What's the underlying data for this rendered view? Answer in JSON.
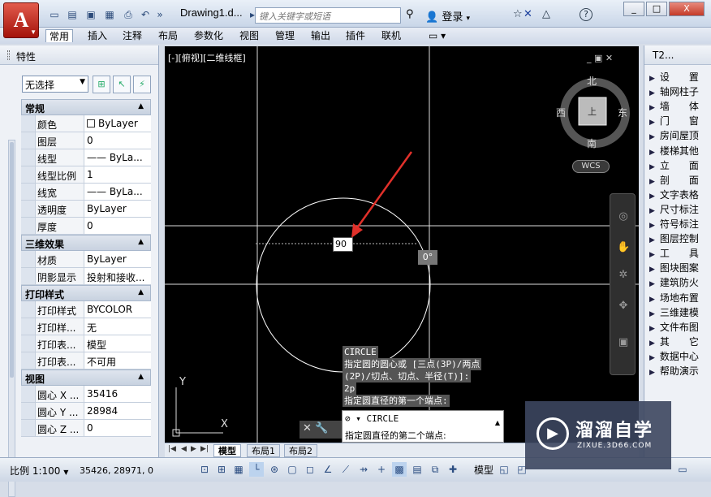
{
  "titlebar": {
    "app_glyph": "A",
    "doc_title": "Drawing1.d...",
    "search_placeholder": "键入关键字或短语",
    "login": "登录",
    "help": "?",
    "window_controls": [
      "_",
      "□",
      "X"
    ]
  },
  "ribbon": {
    "tabs": [
      "常用",
      "插入",
      "注释",
      "布局",
      "参数化",
      "视图",
      "管理",
      "输出",
      "插件",
      "联机"
    ],
    "active_tab": "常用"
  },
  "properties": {
    "title": "特性",
    "selection": "无选择",
    "sections": [
      {
        "name": "常规",
        "rows": [
          {
            "label": "颜色",
            "value": "ByLayer",
            "swatch": true
          },
          {
            "label": "图层",
            "value": "0"
          },
          {
            "label": "线型",
            "value": "—— ByLa...",
            "line": true
          },
          {
            "label": "线型比例",
            "value": "1"
          },
          {
            "label": "线宽",
            "value": "—— ByLa...",
            "line": true
          },
          {
            "label": "透明度",
            "value": "ByLayer"
          },
          {
            "label": "厚度",
            "value": "0"
          }
        ]
      },
      {
        "name": "三维效果",
        "rows": [
          {
            "label": "材质",
            "value": "ByLayer"
          },
          {
            "label": "阴影显示",
            "value": "投射和接收..."
          }
        ]
      },
      {
        "name": "打印样式",
        "rows": [
          {
            "label": "打印样式",
            "value": "BYCOLOR"
          },
          {
            "label": "打印样...",
            "value": "无"
          },
          {
            "label": "打印表...",
            "value": "模型"
          },
          {
            "label": "打印表...",
            "value": "不可用"
          }
        ]
      },
      {
        "name": "视图",
        "rows": [
          {
            "label": "圆心 X ...",
            "value": "35416"
          },
          {
            "label": "圆心 Y ...",
            "value": "28984"
          },
          {
            "label": "圆心 Z ...",
            "value": "0"
          }
        ]
      }
    ]
  },
  "canvas": {
    "view_label": "[-][俯视][二维线框]",
    "viewcube": {
      "north": "北",
      "south": "南",
      "east": "东",
      "west": "西",
      "center": "上"
    },
    "wcs": "WCS",
    "dynamic_input": "90",
    "angle": "0°",
    "ucs_x": "X",
    "ucs_y": "Y",
    "command_history": [
      {
        "text": "CIRCLE",
        "highlight": true
      },
      {
        "text": "指定圆的圆心或 [三点(3P)/两点",
        "highlight": true
      },
      {
        "text": "(2P)/切点、切点、半径(T)]:",
        "highlight": true
      },
      {
        "text": "2p",
        "highlight": true
      },
      {
        "text": "指定圆直径的第一个端点:",
        "highlight": true
      }
    ],
    "command_name": "CIRCLE",
    "command_prompt": "指定圆直径的第二个端点:"
  },
  "layout_tabs": {
    "tabs": [
      "模型",
      "布局1",
      "布局2"
    ],
    "active": "模型"
  },
  "tool_palette": {
    "title": "T2...",
    "items": [
      "设　　置",
      "轴网柱子",
      "墙　　体",
      "门　　窗",
      "房间屋顶",
      "楼梯其他",
      "立　　面",
      "剖　　面",
      "文字表格",
      "尺寸标注",
      "符号标注",
      "图层控制",
      "工　　具",
      "图块图案",
      "建筑防火",
      "场地布置",
      "三维建模",
      "文件布图",
      "其　　它",
      "数据中心",
      "帮助演示"
    ]
  },
  "status_bar": {
    "scale": "比例 1:100",
    "coords": "35426, 28971, 0",
    "model": "模型"
  },
  "watermark": {
    "title": "溜溜自学",
    "url": "ZIXUE.3D66.COM"
  }
}
